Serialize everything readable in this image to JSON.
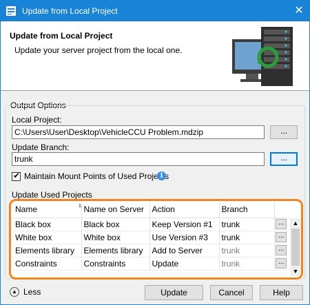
{
  "window": {
    "title": "Update from Local Project",
    "close_glyph": "✕"
  },
  "header": {
    "title": "Update from Local Project",
    "description": "Update your server project from the local one.",
    "art_icon": "server-sync-icon"
  },
  "output_options": {
    "legend": "Output Options",
    "local_project_label": "Local Project:",
    "local_project_value": "C:\\Users\\User\\Desktop\\VehicleCCU Problem.mdzip",
    "update_branch_label": "Update Branch:",
    "update_branch_value": "trunk",
    "browse_label": "...",
    "maintain_mount_label": "Maintain Mount Points of Used Projects",
    "maintain_mount_checked": true,
    "update_used_label": "Update Used Projects"
  },
  "table": {
    "columns": [
      "Name",
      "Name on Server",
      "Action",
      "Branch"
    ],
    "sort_indicator": "1",
    "row_button_label": "...",
    "rows": [
      {
        "name": "Black box",
        "server": "Black box",
        "action": "Keep Version #1",
        "branch": "trunk",
        "branch_dim": false
      },
      {
        "name": "White box",
        "server": "White box",
        "action": "Use Version #3",
        "branch": "trunk",
        "branch_dim": false
      },
      {
        "name": "Elements library",
        "server": "Elements library",
        "action": "Add to Server",
        "branch": "trunk",
        "branch_dim": true
      },
      {
        "name": "Constraints",
        "server": "Constraints",
        "action": "Update",
        "branch": "trunk",
        "branch_dim": true
      }
    ]
  },
  "footer": {
    "less_label": "Less",
    "update_label": "Update",
    "cancel_label": "Cancel",
    "help_label": "Help"
  },
  "colors": {
    "titlebar": "#1883d7",
    "highlight": "#f28520",
    "info": "#3a8ee6"
  }
}
